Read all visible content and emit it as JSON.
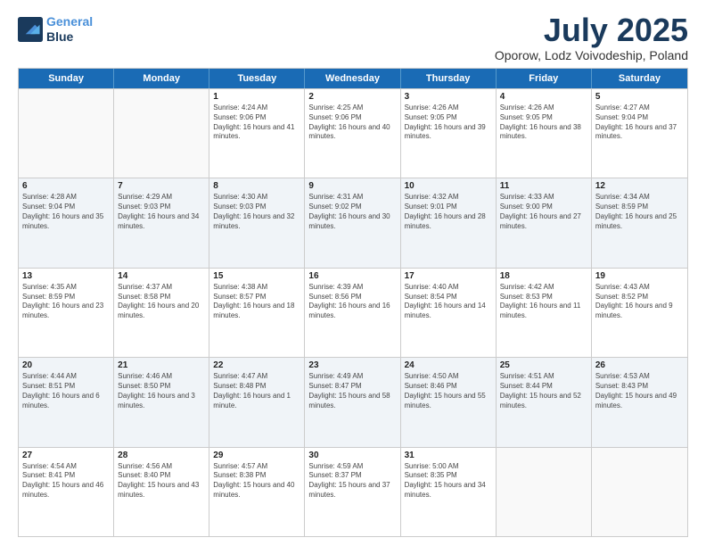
{
  "logo": {
    "line1": "General",
    "line2": "Blue"
  },
  "header": {
    "month": "July 2025",
    "location": "Oporow, Lodz Voivodeship, Poland"
  },
  "weekdays": [
    "Sunday",
    "Monday",
    "Tuesday",
    "Wednesday",
    "Thursday",
    "Friday",
    "Saturday"
  ],
  "rows": [
    [
      {
        "day": "",
        "sunrise": "",
        "sunset": "",
        "daylight": ""
      },
      {
        "day": "",
        "sunrise": "",
        "sunset": "",
        "daylight": ""
      },
      {
        "day": "1",
        "sunrise": "Sunrise: 4:24 AM",
        "sunset": "Sunset: 9:06 PM",
        "daylight": "Daylight: 16 hours and 41 minutes."
      },
      {
        "day": "2",
        "sunrise": "Sunrise: 4:25 AM",
        "sunset": "Sunset: 9:06 PM",
        "daylight": "Daylight: 16 hours and 40 minutes."
      },
      {
        "day": "3",
        "sunrise": "Sunrise: 4:26 AM",
        "sunset": "Sunset: 9:05 PM",
        "daylight": "Daylight: 16 hours and 39 minutes."
      },
      {
        "day": "4",
        "sunrise": "Sunrise: 4:26 AM",
        "sunset": "Sunset: 9:05 PM",
        "daylight": "Daylight: 16 hours and 38 minutes."
      },
      {
        "day": "5",
        "sunrise": "Sunrise: 4:27 AM",
        "sunset": "Sunset: 9:04 PM",
        "daylight": "Daylight: 16 hours and 37 minutes."
      }
    ],
    [
      {
        "day": "6",
        "sunrise": "Sunrise: 4:28 AM",
        "sunset": "Sunset: 9:04 PM",
        "daylight": "Daylight: 16 hours and 35 minutes."
      },
      {
        "day": "7",
        "sunrise": "Sunrise: 4:29 AM",
        "sunset": "Sunset: 9:03 PM",
        "daylight": "Daylight: 16 hours and 34 minutes."
      },
      {
        "day": "8",
        "sunrise": "Sunrise: 4:30 AM",
        "sunset": "Sunset: 9:03 PM",
        "daylight": "Daylight: 16 hours and 32 minutes."
      },
      {
        "day": "9",
        "sunrise": "Sunrise: 4:31 AM",
        "sunset": "Sunset: 9:02 PM",
        "daylight": "Daylight: 16 hours and 30 minutes."
      },
      {
        "day": "10",
        "sunrise": "Sunrise: 4:32 AM",
        "sunset": "Sunset: 9:01 PM",
        "daylight": "Daylight: 16 hours and 28 minutes."
      },
      {
        "day": "11",
        "sunrise": "Sunrise: 4:33 AM",
        "sunset": "Sunset: 9:00 PM",
        "daylight": "Daylight: 16 hours and 27 minutes."
      },
      {
        "day": "12",
        "sunrise": "Sunrise: 4:34 AM",
        "sunset": "Sunset: 8:59 PM",
        "daylight": "Daylight: 16 hours and 25 minutes."
      }
    ],
    [
      {
        "day": "13",
        "sunrise": "Sunrise: 4:35 AM",
        "sunset": "Sunset: 8:59 PM",
        "daylight": "Daylight: 16 hours and 23 minutes."
      },
      {
        "day": "14",
        "sunrise": "Sunrise: 4:37 AM",
        "sunset": "Sunset: 8:58 PM",
        "daylight": "Daylight: 16 hours and 20 minutes."
      },
      {
        "day": "15",
        "sunrise": "Sunrise: 4:38 AM",
        "sunset": "Sunset: 8:57 PM",
        "daylight": "Daylight: 16 hours and 18 minutes."
      },
      {
        "day": "16",
        "sunrise": "Sunrise: 4:39 AM",
        "sunset": "Sunset: 8:56 PM",
        "daylight": "Daylight: 16 hours and 16 minutes."
      },
      {
        "day": "17",
        "sunrise": "Sunrise: 4:40 AM",
        "sunset": "Sunset: 8:54 PM",
        "daylight": "Daylight: 16 hours and 14 minutes."
      },
      {
        "day": "18",
        "sunrise": "Sunrise: 4:42 AM",
        "sunset": "Sunset: 8:53 PM",
        "daylight": "Daylight: 16 hours and 11 minutes."
      },
      {
        "day": "19",
        "sunrise": "Sunrise: 4:43 AM",
        "sunset": "Sunset: 8:52 PM",
        "daylight": "Daylight: 16 hours and 9 minutes."
      }
    ],
    [
      {
        "day": "20",
        "sunrise": "Sunrise: 4:44 AM",
        "sunset": "Sunset: 8:51 PM",
        "daylight": "Daylight: 16 hours and 6 minutes."
      },
      {
        "day": "21",
        "sunrise": "Sunrise: 4:46 AM",
        "sunset": "Sunset: 8:50 PM",
        "daylight": "Daylight: 16 hours and 3 minutes."
      },
      {
        "day": "22",
        "sunrise": "Sunrise: 4:47 AM",
        "sunset": "Sunset: 8:48 PM",
        "daylight": "Daylight: 16 hours and 1 minute."
      },
      {
        "day": "23",
        "sunrise": "Sunrise: 4:49 AM",
        "sunset": "Sunset: 8:47 PM",
        "daylight": "Daylight: 15 hours and 58 minutes."
      },
      {
        "day": "24",
        "sunrise": "Sunrise: 4:50 AM",
        "sunset": "Sunset: 8:46 PM",
        "daylight": "Daylight: 15 hours and 55 minutes."
      },
      {
        "day": "25",
        "sunrise": "Sunrise: 4:51 AM",
        "sunset": "Sunset: 8:44 PM",
        "daylight": "Daylight: 15 hours and 52 minutes."
      },
      {
        "day": "26",
        "sunrise": "Sunrise: 4:53 AM",
        "sunset": "Sunset: 8:43 PM",
        "daylight": "Daylight: 15 hours and 49 minutes."
      }
    ],
    [
      {
        "day": "27",
        "sunrise": "Sunrise: 4:54 AM",
        "sunset": "Sunset: 8:41 PM",
        "daylight": "Daylight: 15 hours and 46 minutes."
      },
      {
        "day": "28",
        "sunrise": "Sunrise: 4:56 AM",
        "sunset": "Sunset: 8:40 PM",
        "daylight": "Daylight: 15 hours and 43 minutes."
      },
      {
        "day": "29",
        "sunrise": "Sunrise: 4:57 AM",
        "sunset": "Sunset: 8:38 PM",
        "daylight": "Daylight: 15 hours and 40 minutes."
      },
      {
        "day": "30",
        "sunrise": "Sunrise: 4:59 AM",
        "sunset": "Sunset: 8:37 PM",
        "daylight": "Daylight: 15 hours and 37 minutes."
      },
      {
        "day": "31",
        "sunrise": "Sunrise: 5:00 AM",
        "sunset": "Sunset: 8:35 PM",
        "daylight": "Daylight: 15 hours and 34 minutes."
      },
      {
        "day": "",
        "sunrise": "",
        "sunset": "",
        "daylight": ""
      },
      {
        "day": "",
        "sunrise": "",
        "sunset": "",
        "daylight": ""
      }
    ]
  ]
}
